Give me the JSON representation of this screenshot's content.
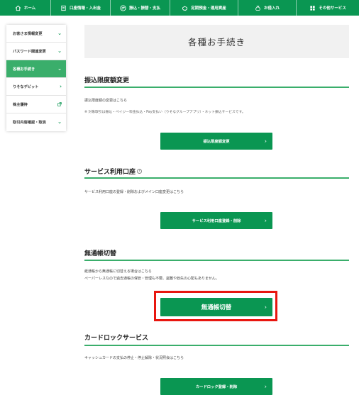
{
  "nav": [
    {
      "label": "ホーム",
      "icon": "home-icon"
    },
    {
      "label": "口座情報・入出金",
      "icon": "passbook-icon"
    },
    {
      "label": "振込・振替・支払",
      "icon": "transfer-icon"
    },
    {
      "label": "定期預金・運用資産",
      "icon": "piggy-bank-icon"
    },
    {
      "label": "お借入れ",
      "icon": "money-bag-icon"
    },
    {
      "label": "その他サービス",
      "icon": "grid-icon"
    }
  ],
  "sidebar": {
    "items": [
      {
        "label": "お客さま情報変更",
        "state": "collapsed"
      },
      {
        "label": "パスワード関連変更",
        "state": "collapsed"
      },
      {
        "label": "各種お手続き",
        "state": "active"
      },
      {
        "label": "りそなデビット",
        "state": "link"
      },
      {
        "label": "株主優待",
        "state": "external"
      },
      {
        "label": "取引内容確認・取消",
        "state": "collapsed"
      }
    ]
  },
  "page": {
    "title": "各種お手続き"
  },
  "sections": {
    "limit": {
      "title": "振込限度額変更",
      "desc": "振込限度額の変更はこちら",
      "note": "※ 対象取引は振込・ペイジー料金払込・Pay支払い（りそなグループアプリ）・ネット振込サービスです。",
      "button": "振込限度額変更"
    },
    "account": {
      "title": "サービス利用口座",
      "info_glyph": "?",
      "desc": "サービス利用口座の登録・削除およびメイン口座変更はこちら",
      "button": "サービス利用口座登録・削除"
    },
    "passbook": {
      "title": "無通帳切替",
      "desc1": "紙通帳から無通帳に切替える場合はこちら",
      "desc2": "ペーパーレスなので過去通帳の保管・管理も不要。盗難や紛失の心配もありません。",
      "button": "無通帳切替"
    },
    "card": {
      "title": "カードロックサービス",
      "desc": "キャッシュカードの支払の停止・停止解除・状況照会はこちら",
      "button": "カードロック登録・削除"
    }
  },
  "glyphs": {
    "chevron_right": "›",
    "chevron_down": "⌄"
  },
  "colors": {
    "brand_green": "#0a9652",
    "active_green": "#3aae6b",
    "highlight_red": "#e8160f"
  }
}
